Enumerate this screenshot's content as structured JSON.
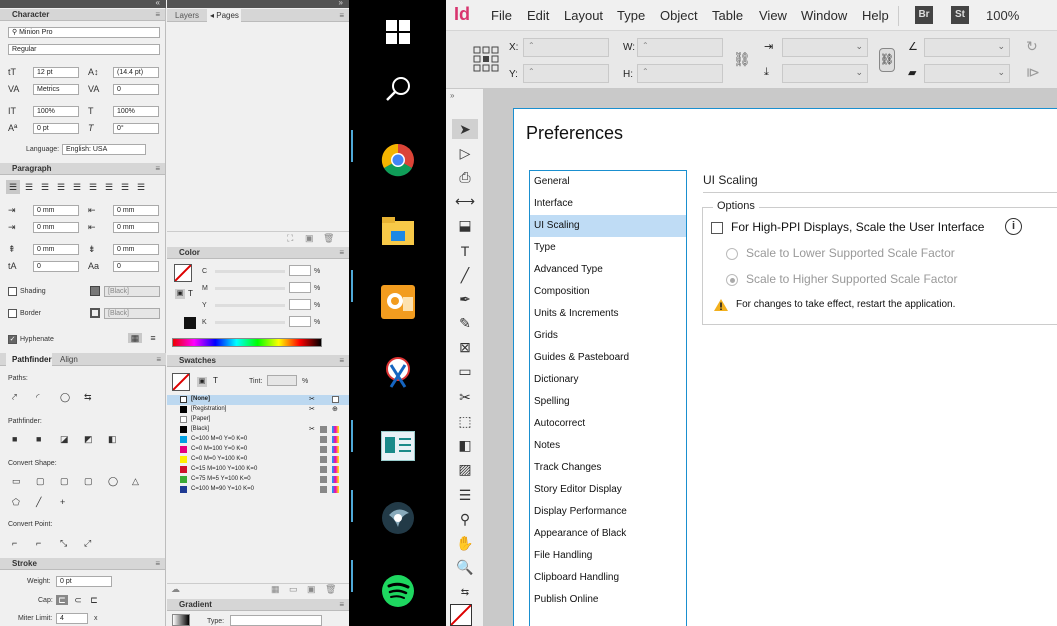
{
  "left_panels": {
    "character": {
      "title": "Character",
      "font_family": "Minion Pro",
      "font_style": "Regular",
      "size": "12 pt",
      "leading": "(14.4 pt)",
      "kerning": "Metrics",
      "tracking": "0",
      "v_scale": "100%",
      "h_scale": "100%",
      "baseline": "0 pt",
      "skew": "0°",
      "language_label": "Language:",
      "language": "English: USA"
    },
    "paragraph": {
      "title": "Paragraph",
      "fields": [
        "0 mm",
        "0 mm",
        "0 mm",
        "0 mm",
        "0 mm",
        "0 mm",
        "0",
        "0"
      ],
      "shading_label": "Shading",
      "shading_value": "[Black]",
      "border_label": "Border",
      "border_value": "[Black]",
      "hyphenate_label": "Hyphenate"
    },
    "pathfinder": {
      "tabs": [
        "Pathfinder",
        "Align"
      ],
      "paths_label": "Paths:",
      "pathfinder_label": "Pathfinder:",
      "convert_shape_label": "Convert Shape:",
      "convert_point_label": "Convert Point:"
    },
    "stroke": {
      "title": "Stroke",
      "weight_label": "Weight:",
      "weight_value": "0 pt",
      "cap_label": "Cap:",
      "miter_label": "Miter Limit:",
      "miter_value": "4",
      "miter_x": "x"
    }
  },
  "right_panels": {
    "tabs": [
      "Layers",
      "Pages"
    ],
    "color": {
      "title": "Color",
      "channels": [
        "C",
        "M",
        "Y",
        "K"
      ],
      "pct": "%"
    },
    "swatches": {
      "title": "Swatches",
      "tint_label": "Tint:",
      "tint_pct": "%",
      "items": [
        {
          "name": "[None]",
          "color": "#ffffff"
        },
        {
          "name": "[Registration]",
          "color": "#000000"
        },
        {
          "name": "[Paper]",
          "color": "#ffffff"
        },
        {
          "name": "[Black]",
          "color": "#000000"
        },
        {
          "name": "C=100 M=0 Y=0 K=0",
          "color": "#00a0e3"
        },
        {
          "name": "C=0 M=100 Y=0 K=0",
          "color": "#e4007f"
        },
        {
          "name": "C=0 M=0 Y=100 K=0",
          "color": "#fff000"
        },
        {
          "name": "C=15 M=100 Y=100 K=0",
          "color": "#d0112b"
        },
        {
          "name": "C=75 M=5 Y=100 K=0",
          "color": "#3aa935"
        },
        {
          "name": "C=100 M=90 Y=10 K=0",
          "color": "#1f3a93"
        }
      ]
    },
    "gradient": {
      "title": "Gradient",
      "type_label": "Type:"
    }
  },
  "taskbar": {
    "icons": [
      "windows-start-icon",
      "search-icon",
      "chrome-icon",
      "file-explorer-icon",
      "outlook-icon",
      "snipping-tool-icon",
      "presentation-app-icon",
      "media-app-icon",
      "spotify-icon"
    ]
  },
  "indesign": {
    "logo": "Id",
    "menus": [
      "File",
      "Edit",
      "Layout",
      "Type",
      "Object",
      "Table",
      "View",
      "Window",
      "Help"
    ],
    "bridge": "Br",
    "stock": "St",
    "zoom": "100%",
    "x_label": "X:",
    "y_label": "Y:",
    "w_label": "W:",
    "h_label": "H:"
  },
  "preferences": {
    "title": "Preferences",
    "categories": [
      "General",
      "Interface",
      "UI Scaling",
      "Type",
      "Advanced Type",
      "Composition",
      "Units & Increments",
      "Grids",
      "Guides & Pasteboard",
      "Dictionary",
      "Spelling",
      "Autocorrect",
      "Notes",
      "Track Changes",
      "Story Editor Display",
      "Display Performance",
      "Appearance of Black",
      "File Handling",
      "Clipboard Handling",
      "Publish Online"
    ],
    "selected_index": 2,
    "section_title": "UI Scaling",
    "options_label": "Options",
    "high_ppi_label": "For High-PPI Displays, Scale the User Interface",
    "lower_label": "Scale to Lower Supported Scale Factor",
    "higher_label": "Scale to Higher Supported Scale Factor",
    "warning": "For changes to take effect, restart the application."
  }
}
